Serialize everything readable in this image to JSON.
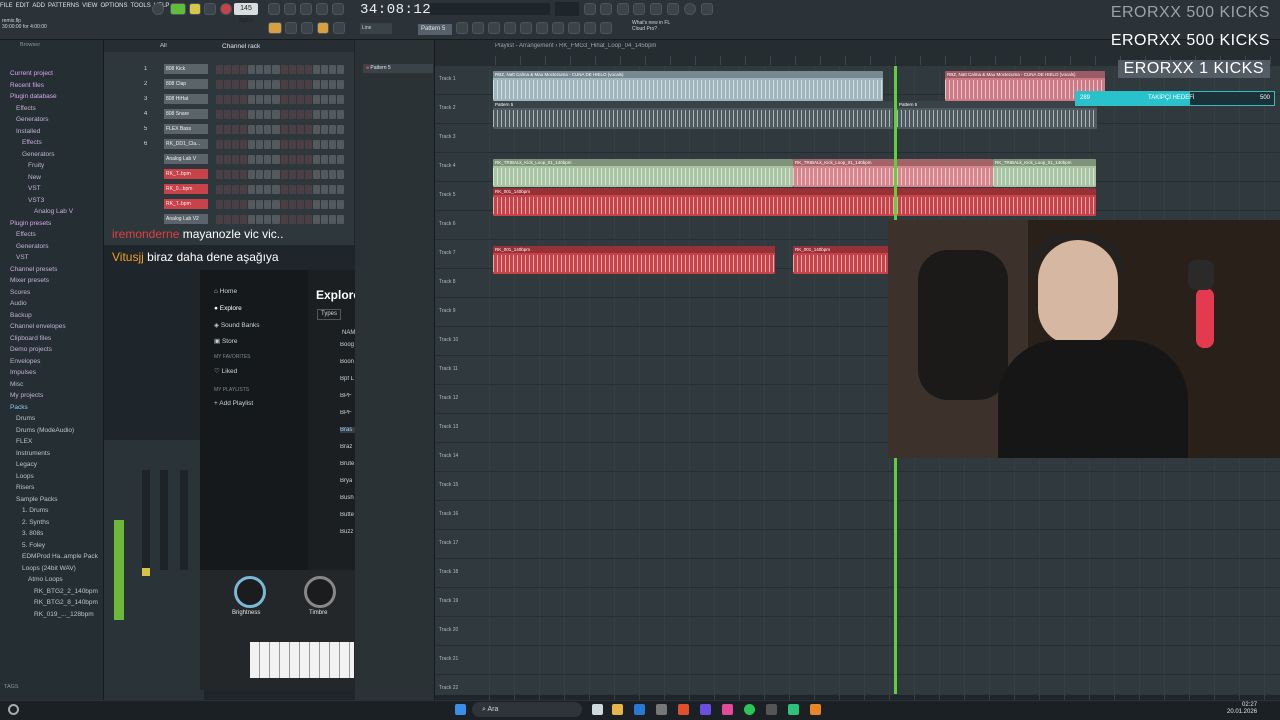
{
  "menu": [
    "FILE",
    "EDIT",
    "ADD",
    "PATTERNS",
    "VIEW",
    "OPTIONS",
    "TOOLS",
    "HELP"
  ],
  "transport": {
    "bpm": "145 bpm",
    "time": "34:08:12",
    "pattern": "Pattern 5",
    "hint_line1": "remix.flp",
    "hint_line2": "30:00:00 for 4:00:00"
  },
  "news": {
    "line1": "What's new in FL",
    "line2": "Cloud Pro?"
  },
  "browser": {
    "title": "Browser",
    "items": [
      "Current project",
      "Recent files",
      "Plugin database",
      "Effects",
      "Generators",
      "Installed",
      "Effects",
      "Generators",
      "Fruity",
      "New",
      "VST",
      "VST3",
      "Analog Lab V",
      "Plugin presets",
      "Effects",
      "Generators",
      "VST",
      "Channel presets",
      "Mixer presets",
      "Scores",
      "Audio",
      "Backup",
      "Channel envelopes",
      "Clipboard files",
      "Demo projects",
      "Envelopes",
      "Impulses",
      "Misc",
      "My projects",
      "Packs",
      "Drums",
      "Drums (ModeAudio)",
      "FLEX",
      "Instruments",
      "Legacy",
      "Loops",
      "Risers",
      "Sample Packs",
      "1. Drums",
      "2. Synths",
      "3. 808s",
      "5. Foley",
      "EDMProd Ha..ample Pack",
      "Loops (24bit WAV)",
      "Atmo Loops",
      "RK_BTG2_2_140bpm",
      "RK_BTG2_8_140bpm",
      "RK_019_..._128bpm"
    ],
    "footer": "TAGS"
  },
  "channel_rack": {
    "title": "Channel rack",
    "filter": "All",
    "channels": [
      "808 Kick",
      "808 Clap",
      "808 HiHat",
      "808 Snare",
      "FLEX Bass",
      "RK_DD1_Cla...",
      "Analog Lab V",
      "RK_T..bpm",
      "RK_0...bpm",
      "RK_T..bpm",
      "Analog Lab V2"
    ],
    "numbers": [
      "1",
      "2",
      "3",
      "4",
      "5",
      "6",
      "",
      "",
      "",
      "",
      ""
    ]
  },
  "chat": [
    {
      "user": "iremonderne",
      "message": "mayanozle vic vic..",
      "user_color": "#e04040"
    },
    {
      "user": "Vitusjj",
      "message": "biraz daha dene aşağıya",
      "user_color": "#f0a020"
    }
  ],
  "plugin": {
    "nav": [
      "Home",
      "Explore",
      "Sound Banks",
      "Store"
    ],
    "favorites_label": "MY FAVORITES",
    "liked": "Liked",
    "playlists_label": "MY PLAYLISTS",
    "add_playlist": "Add Playlist",
    "explore_title": "Explore",
    "types_button": "Types",
    "column_name": "NAM",
    "presets": [
      "Boog",
      "Boon",
      "Bpf L",
      "BPF",
      "BPF",
      "Bras",
      "Braz",
      "Brute",
      "Brya",
      "Bush",
      "Butte",
      "Buzz"
    ],
    "knobs": [
      "Brightness",
      "Timbre"
    ]
  },
  "playlist": {
    "title": "Playlist - Arrangement › RK_FMG3_Hihat_Loop_04_145bpm",
    "pattern_item": "Pattern 5",
    "tracks": [
      "Track 1",
      "Track 2",
      "Track 3",
      "Track 4",
      "Track 5",
      "Track 6",
      "Track 7",
      "Track 8",
      "Track 9",
      "Track 10",
      "Track 11",
      "Track 12",
      "Track 13",
      "Track 14",
      "Track 15",
      "Track 16",
      "Track 17",
      "Track 18",
      "Track 19",
      "Track 20",
      "Track 21",
      "Track 22"
    ],
    "clip_labels": {
      "vocal": "RBZ, Natt Calma & Mau Moctezuma - CUNA DE HIELO (vocals)",
      "pattern": "Pattern 5",
      "kick": "RK_TRIBALk_Kick_Loop_01_140bpm",
      "loop": "RK_001_140bpm"
    }
  },
  "overlay": {
    "kicks": [
      "ERORXX  500 KICKS",
      "ERORXX  500 KICKS",
      "ERORXX  1 KICKS"
    ],
    "follower_label": "TAKİPÇİ HEDEFİ",
    "follower_current": "289",
    "follower_goal": "500",
    "follower_progress": 0.578
  },
  "taskbar": {
    "search": "Ara",
    "time": "02:27",
    "date": "20.01.2026"
  },
  "colors": {
    "accent_green": "#5fcf3a",
    "clip_red": "#c8424a",
    "clip_green": "#a9c4a2",
    "follower_cyan": "#27c2cc"
  }
}
